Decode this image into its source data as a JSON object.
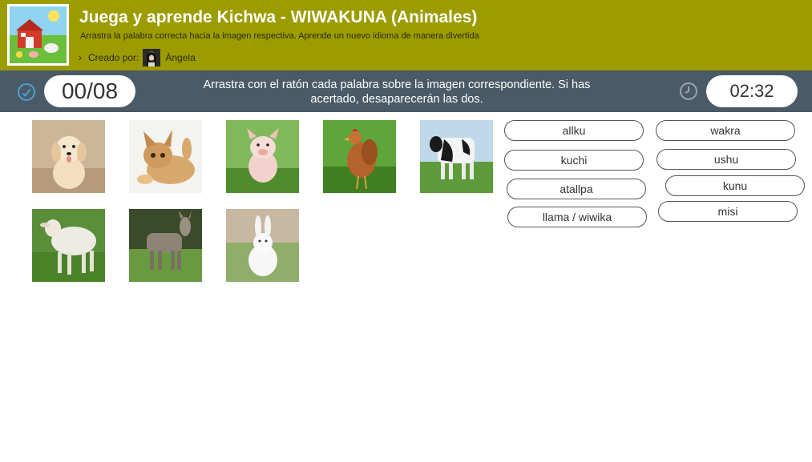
{
  "header": {
    "title": "Juega y aprende Kichwa - WIWAKUNA (Animales)",
    "subtitle": "Arrastra la palabra correcta hacia la imagen respectiva. Aprende un nuevo idioma de manera divertida",
    "creator_label": "Creado por:",
    "creator_name": "Àngela",
    "thumbnail_icon": "farm-illustration"
  },
  "toolbar": {
    "score": "00/08",
    "instructions": "Arrastra con el ratón cada palabra sobre la imagen correspondiente. Si has acertado, desaparecerán las dos.",
    "timer": "02:32",
    "score_icon": "check-circle-icon",
    "timer_icon": "clock-icon"
  },
  "images": [
    "puppy",
    "kitten",
    "piglet",
    "hen",
    "cow",
    "sheep",
    "donkey",
    "rabbit"
  ],
  "words": [
    "allku",
    "wakra",
    "kuchi",
    "ushu",
    "atallpa",
    "kunu",
    "llama / wiwika",
    "misi"
  ],
  "colors": {
    "header_bg": "#9c9c00",
    "toolbar_bg": "#4a5a66",
    "icon_accent": "#4a9fd8"
  }
}
